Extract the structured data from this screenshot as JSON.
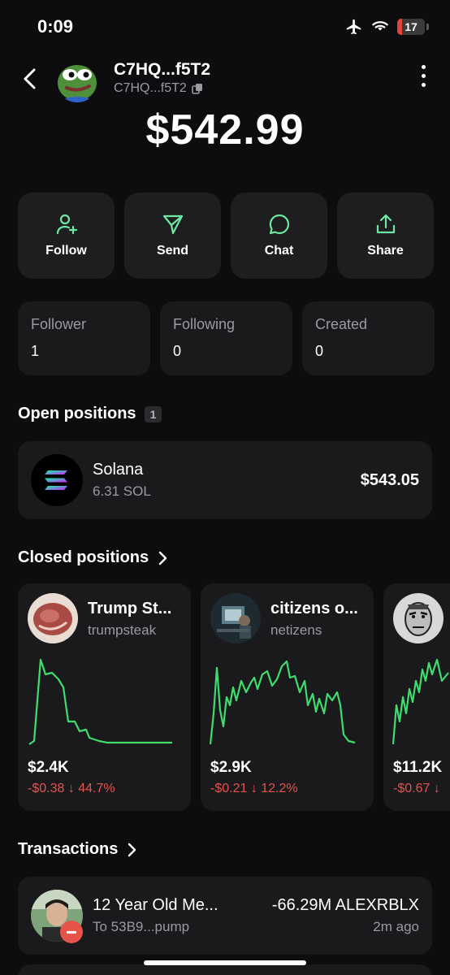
{
  "status_bar": {
    "time": "0:09",
    "battery": "17",
    "battery_level": 0.17,
    "battery_color": "#e0453a",
    "icons": [
      "airplane-icon",
      "wifi-icon",
      "battery-icon"
    ]
  },
  "header": {
    "wallet_name": "C7HQ...f5T2",
    "wallet_address": "C7HQ...f5T2",
    "icons": [
      "chevron-left-icon",
      "copy-icon",
      "more-vertical-icon"
    ]
  },
  "balance": "$542.99",
  "actions": [
    {
      "label": "Follow",
      "icon": "user-plus-icon"
    },
    {
      "label": "Send",
      "icon": "send-icon"
    },
    {
      "label": "Chat",
      "icon": "chat-icon"
    },
    {
      "label": "Share",
      "icon": "share-icon"
    }
  ],
  "accent_color": "#6ee7a0",
  "stats": [
    {
      "label": "Follower",
      "value": "1"
    },
    {
      "label": "Following",
      "value": "0"
    },
    {
      "label": "Created",
      "value": "0"
    }
  ],
  "open_positions": {
    "title": "Open positions",
    "count": "1",
    "items": [
      {
        "name": "Solana",
        "amount": "6.31 SOL",
        "value": "$543.05",
        "icon": "solana-logo-icon"
      }
    ]
  },
  "closed_positions": {
    "title": "Closed positions",
    "negative_color": "#e5534b",
    "chart_color": "#3fdc6e",
    "items": [
      {
        "name": "Trump St...",
        "ticker": "trumpsteak",
        "value": "$2.4K",
        "change": "-$0.38 ↓ 44.7%"
      },
      {
        "name": "citizens o...",
        "ticker": "netizens",
        "value": "$2.9K",
        "change": "-$0.21 ↓ 12.2%"
      },
      {
        "name": "",
        "ticker": "",
        "value": "$11.2K",
        "change": "-$0.67 ↓"
      }
    ]
  },
  "transactions": {
    "title": "Transactions",
    "items": [
      {
        "name": "12 Year Old Me...",
        "to": "To 53B9...pump",
        "amount": "-66.29M ALEXRBLX",
        "time": "2m ago"
      }
    ]
  }
}
